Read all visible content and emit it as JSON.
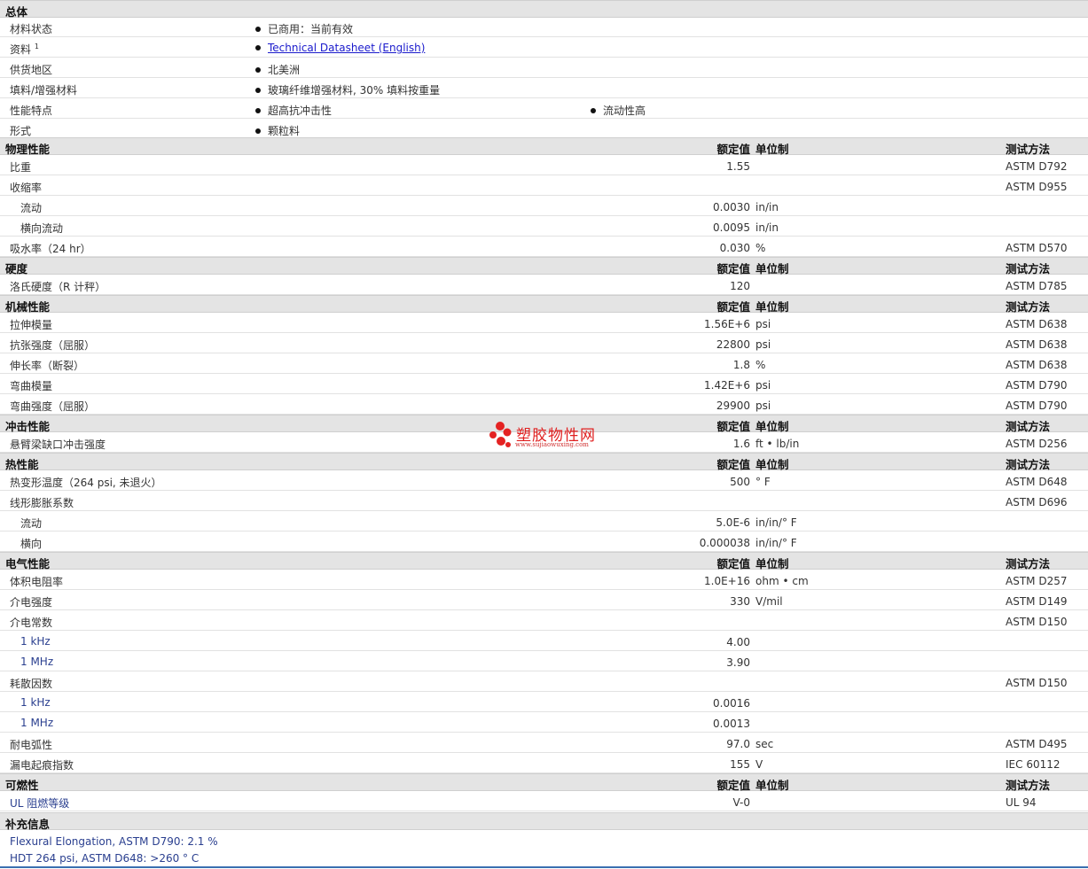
{
  "headers": {
    "value": "额定值",
    "unit": "单位制",
    "method": "测试方法"
  },
  "general": {
    "title": "总体",
    "status_label": "材料状态",
    "status_value": "已商用：当前有效",
    "docs_label": "资料",
    "docs_sup": "1",
    "docs_link": "Technical Datasheet (English)",
    "region_label": "供货地区",
    "region_value": "北美洲",
    "filler_label": "填料/增强材料",
    "filler_value": "玻璃纤维增强材料, 30% 填料按重量",
    "features_label": "性能特点",
    "features": [
      "超高抗冲击性",
      "流动性高"
    ],
    "form_label": "形式",
    "form_value": "颗粒料"
  },
  "physical": {
    "title": "物理性能",
    "rows": [
      {
        "label": "比重",
        "value": "1.55",
        "unit": "",
        "method": "ASTM D792"
      },
      {
        "label": "收缩率",
        "value": "",
        "unit": "",
        "method": "ASTM D955"
      },
      {
        "label": "流动",
        "value": "0.0030",
        "unit": "in/in",
        "method": ""
      },
      {
        "label": "横向流动",
        "value": "0.0095",
        "unit": "in/in",
        "method": ""
      },
      {
        "label": "吸水率（24 hr）",
        "value": "0.030",
        "unit": "%",
        "method": "ASTM D570"
      }
    ]
  },
  "hardness": {
    "title": "硬度",
    "rows": [
      {
        "label": "洛氏硬度（R 计秤）",
        "value": "120",
        "unit": "",
        "method": "ASTM D785"
      }
    ]
  },
  "mechanical": {
    "title": "机械性能",
    "rows": [
      {
        "label": "拉伸模量",
        "value": "1.56E+6",
        "unit": "psi",
        "method": "ASTM D638"
      },
      {
        "label": "抗张强度（屈服）",
        "value": "22800",
        "unit": "psi",
        "method": "ASTM D638"
      },
      {
        "label": "伸长率（断裂）",
        "value": "1.8",
        "unit": "%",
        "method": "ASTM D638"
      },
      {
        "label": "弯曲模量",
        "value": "1.42E+6",
        "unit": "psi",
        "method": "ASTM D790"
      },
      {
        "label": "弯曲强度（屈服）",
        "value": "29900",
        "unit": "psi",
        "method": "ASTM D790"
      }
    ]
  },
  "impact": {
    "title": "冲击性能",
    "rows": [
      {
        "label": "悬臂梁缺口冲击强度",
        "value": "1.6",
        "unit": "ft • lb/in",
        "method": "ASTM D256"
      }
    ]
  },
  "thermal": {
    "title": "热性能",
    "rows": [
      {
        "label": "热变形温度（264 psi, 未退火）",
        "value": "500",
        "unit": "° F",
        "method": "ASTM D648"
      },
      {
        "label": "线形膨胀系数",
        "value": "",
        "unit": "",
        "method": "ASTM D696"
      },
      {
        "label": "流动",
        "value": "5.0E-6",
        "unit": "in/in/° F",
        "method": ""
      },
      {
        "label": "横向",
        "value": "0.000038",
        "unit": "in/in/° F",
        "method": ""
      }
    ]
  },
  "electrical": {
    "title": "电气性能",
    "rows": [
      {
        "label": "体积电阻率",
        "value": "1.0E+16",
        "unit": "ohm • cm",
        "method": "ASTM D257"
      },
      {
        "label": "介电强度",
        "value": "330",
        "unit": "V/mil",
        "method": "ASTM D149"
      },
      {
        "label": "介电常数",
        "value": "",
        "unit": "",
        "method": "ASTM D150"
      },
      {
        "label": "1 kHz",
        "value": "4.00",
        "unit": "",
        "method": ""
      },
      {
        "label": "1 MHz",
        "value": "3.90",
        "unit": "",
        "method": ""
      },
      {
        "label": "耗散因数",
        "value": "",
        "unit": "",
        "method": "ASTM D150"
      },
      {
        "label": "1 kHz",
        "value": "0.0016",
        "unit": "",
        "method": ""
      },
      {
        "label": "1 MHz",
        "value": "0.0013",
        "unit": "",
        "method": ""
      },
      {
        "label": "耐电弧性",
        "value": "97.0",
        "unit": "sec",
        "method": "ASTM D495"
      },
      {
        "label": "漏电起痕指数",
        "value": "155",
        "unit": "V",
        "method": "IEC 60112"
      }
    ]
  },
  "flammability": {
    "title": "可燃性",
    "rows": [
      {
        "label": "UL 阻燃等级",
        "value": "V-0",
        "unit": "",
        "method": "UL 94"
      }
    ]
  },
  "supplemental": {
    "title": "补充信息",
    "lines": [
      "Flexural Elongation, ASTM D790: 2.1 %",
      "HDT 264 psi, ASTM D648: >260 °  C"
    ]
  },
  "watermark": {
    "text": "塑胶物性网",
    "url": "www.sujiaowuxing.com"
  }
}
